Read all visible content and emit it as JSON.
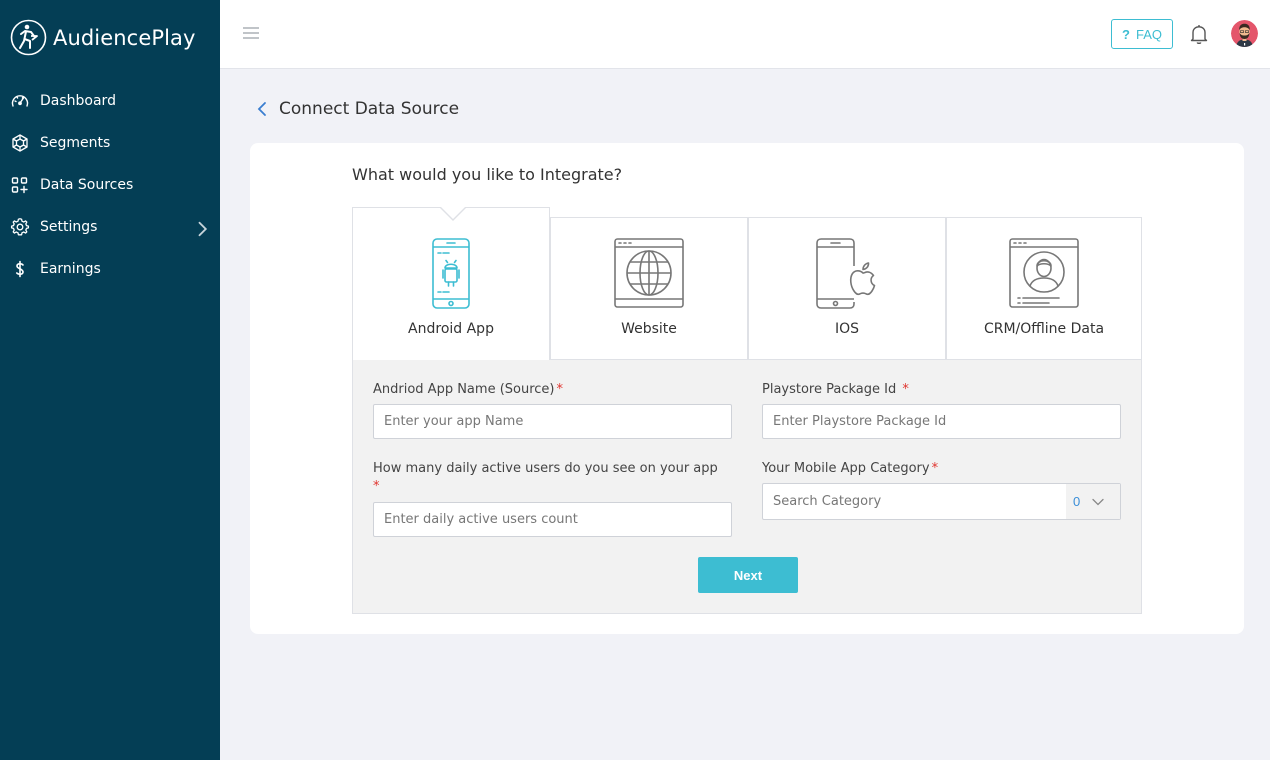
{
  "app": {
    "name": "AudiencePlay"
  },
  "sidebar": {
    "items": [
      {
        "label": "Dashboard",
        "icon": "gauge-icon"
      },
      {
        "label": "Segments",
        "icon": "network-icon"
      },
      {
        "label": "Data Sources",
        "icon": "data-sources-icon"
      },
      {
        "label": "Settings",
        "icon": "gear-icon"
      },
      {
        "label": "Earnings",
        "icon": "dollar-icon"
      }
    ]
  },
  "topbar": {
    "faq_icon": "?",
    "faq_label": "FAQ"
  },
  "page": {
    "title": "Connect Data Source"
  },
  "integrate": {
    "question": "What would you like to Integrate?",
    "tabs": [
      {
        "label": "Android App",
        "icon": "android-phone-icon",
        "active": true
      },
      {
        "label": "Website",
        "icon": "globe-browser-icon",
        "active": false
      },
      {
        "label": "IOS",
        "icon": "apple-phone-icon",
        "active": false
      },
      {
        "label": "CRM/Offline Data",
        "icon": "user-profile-icon",
        "active": false
      }
    ]
  },
  "form": {
    "app_name": {
      "label": "Andriod App Name (Source)",
      "required": "*",
      "placeholder": "Enter your app Name"
    },
    "package_id": {
      "label": "Playstore Package Id",
      "required": "*",
      "placeholder": "Enter Playstore Package Id"
    },
    "dau": {
      "label": "How many daily active users do you see on your app",
      "required": "*",
      "placeholder": "Enter daily active users count"
    },
    "category": {
      "label": "Your Mobile App Category",
      "required": "*",
      "placeholder": "Search Category",
      "count": "0"
    },
    "next_label": "Next"
  },
  "colors": {
    "sidebar": "#043e55",
    "accent": "#3dbdd2",
    "required": "#e0332d"
  }
}
